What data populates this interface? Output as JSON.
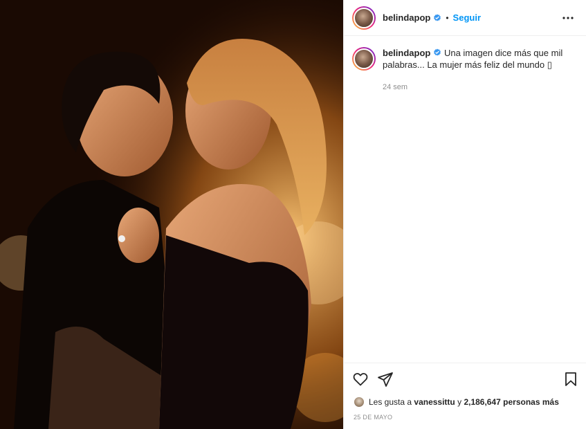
{
  "post": {
    "username": "belindapop",
    "follow_label": "Seguir",
    "separator": "•",
    "caption_text": "Una imagen dice más que mil palabras... La mujer más feliz del mundo ▯",
    "time_ago": "24 sem",
    "likes_prefix": "Les gusta a",
    "likes_user": "vanessittu",
    "likes_mid": "y",
    "likes_count": "2,186,647 personas más",
    "date": "25 DE MAYO"
  },
  "icons": {
    "verified": "verified-badge-icon",
    "more": "more-options-icon",
    "like": "heart-icon",
    "share": "send-icon",
    "save": "bookmark-icon"
  },
  "colors": {
    "accent": "#0095f6",
    "verified": "#3897f0",
    "text": "#262626",
    "muted": "#8e8e8e"
  }
}
